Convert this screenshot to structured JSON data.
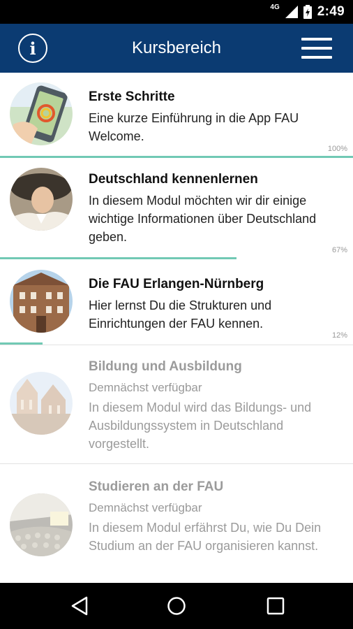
{
  "status_bar": {
    "network": "4G",
    "time": "2:49"
  },
  "app_bar": {
    "info_icon": "info-icon",
    "title": "Kursbereich",
    "menu_icon": "hamburger-menu-icon"
  },
  "colors": {
    "app_bar": "#0b3b72",
    "progress": "#71c9b4"
  },
  "courses": [
    {
      "title": "Erste Schritte",
      "availability": "",
      "description": "Eine kurze Einführung in die App FAU Welcome.",
      "progress": 1.0,
      "progress_label": "100%",
      "enabled": true
    },
    {
      "title": "Deutschland kennenlernen",
      "availability": "",
      "description": "In diesem Modul möchten wir dir einige wichtige Informationen über Deutschland geben.",
      "progress": 0.67,
      "progress_label": "67%",
      "enabled": true
    },
    {
      "title": "Die FAU Erlangen-Nürnberg",
      "availability": "",
      "description": "Hier lernst Du die Strukturen und Einrichtungen der FAU kennen.",
      "progress": 0.12,
      "progress_label": "12%",
      "enabled": true
    },
    {
      "title": "Bildung und Ausbildung",
      "availability": "Demnächst verfügbar",
      "description": "In diesem Modul wird das Bildungs- und Ausbildungssystem in Deutschland vorgestellt.",
      "progress": null,
      "progress_label": "",
      "enabled": false
    },
    {
      "title": "Studieren an der FAU",
      "availability": "Demnächst verfügbar",
      "description": "In diesem Modul erfährst Du, wie Du Dein Studium an der FAU organisieren kannst.",
      "progress": null,
      "progress_label": "",
      "enabled": false
    }
  ],
  "nav_bar": {
    "back": "back-icon",
    "home": "home-icon",
    "recents": "recents-icon"
  }
}
